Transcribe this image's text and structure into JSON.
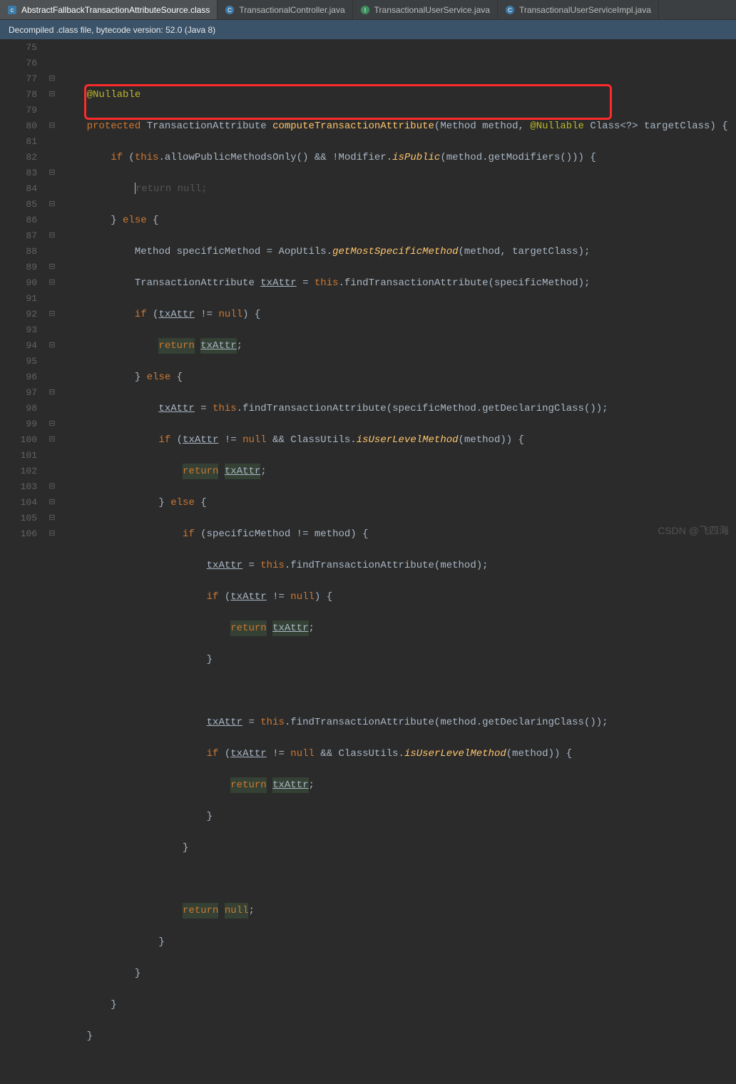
{
  "tabs": [
    {
      "label": "AbstractFallbackTransactionAttributeSource.class",
      "active": true,
      "icon": "class"
    },
    {
      "label": "TransactionalController.java",
      "active": false,
      "icon": "java"
    },
    {
      "label": "TransactionalUserService.java",
      "active": false,
      "icon": "java"
    },
    {
      "label": "TransactionalUserServiceImpl.java",
      "active": false,
      "icon": "java"
    }
  ],
  "banner": {
    "text": "Decompiled .class file, bytecode version: 52.0 (Java 8)"
  },
  "gutter": {
    "start": 75,
    "end": 106
  },
  "watermark": "CSDN @飞四海",
  "code": {
    "l75": "",
    "l76_ann": "@Nullable",
    "l77_kw1": "protected",
    "l77_typ": "TransactionAttribute",
    "l77_mth": "computeTransactionAttribute",
    "l77_args_a": "(Method method, ",
    "l77_ann": "@Nullable",
    "l77_args_b": " Class<?> targetClass) {",
    "l78_kw": "if",
    "l78_open": " (",
    "l78_this": "this",
    "l78_a": ".allowPublicMethodsOnly() && !Modifier.",
    "l78_mth": "isPublic",
    "l78_b": "(method.getModifiers())) {",
    "l79_ret": "return",
    "l79_null": "null",
    "l79_semi": ";",
    "l80_a": "} ",
    "l80_kw": "else",
    "l80_b": " {",
    "l81_a": "Method specificMethod = AopUtils.",
    "l81_mth": "getMostSpecificMethod",
    "l81_b": "(method, targetClass);",
    "l82_a": "TransactionAttribute ",
    "l82_v": "txAttr",
    "l82_b": " = ",
    "l82_this": "this",
    "l82_c": ".findTransactionAttribute(specificMethod);",
    "l83_kw": "if",
    "l83_a": " (",
    "l83_v": "txAttr",
    "l83_b": " != ",
    "l83_n": "null",
    "l83_c": ") {",
    "l84_r": "return",
    "l84_s": " ",
    "l84_v": "txAttr",
    "l84_e": ";",
    "l85_a": "} ",
    "l85_kw": "else",
    "l85_b": " {",
    "l86_v": "txAttr",
    "l86_a": " = ",
    "l86_this": "this",
    "l86_b": ".findTransactionAttribute(specificMethod.getDeclaringClass());",
    "l87_kw": "if",
    "l87_a": " (",
    "l87_v": "txAttr",
    "l87_b": " != ",
    "l87_n": "null",
    "l87_c": " && ClassUtils.",
    "l87_mth": "isUserLevelMethod",
    "l87_d": "(method)) {",
    "l88_r": "return",
    "l88_s": " ",
    "l88_v": "txAttr",
    "l88_e": ";",
    "l89_a": "} ",
    "l89_kw": "else",
    "l89_b": " {",
    "l90_kw": "if",
    "l90_a": " (specificMethod != method) {",
    "l91_v": "txAttr",
    "l91_a": " = ",
    "l91_this": "this",
    "l91_b": ".findTransactionAttribute(method);",
    "l92_kw": "if",
    "l92_a": " (",
    "l92_v": "txAttr",
    "l92_b": " != ",
    "l92_n": "null",
    "l92_c": ") {",
    "l93_r": "return",
    "l93_s": " ",
    "l93_v": "txAttr",
    "l93_e": ";",
    "l94_a": "}",
    "l95": "",
    "l96_v": "txAttr",
    "l96_a": " = ",
    "l96_this": "this",
    "l96_b": ".findTransactionAttribute(method.getDeclaringClass());",
    "l97_kw": "if",
    "l97_a": " (",
    "l97_v": "txAttr",
    "l97_b": " != ",
    "l97_n": "null",
    "l97_c": " && ClassUtils.",
    "l97_mth": "isUserLevelMethod",
    "l97_d": "(method)) {",
    "l98_r": "return",
    "l98_s": " ",
    "l98_v": "txAttr",
    "l98_e": ";",
    "l99_a": "}",
    "l100_a": "}",
    "l101": "",
    "l102_r": "return",
    "l102_s": " ",
    "l102_n": "null",
    "l102_e": ";",
    "l103_a": "}",
    "l104_a": "}",
    "l105_a": "}",
    "l106_a": "}"
  }
}
